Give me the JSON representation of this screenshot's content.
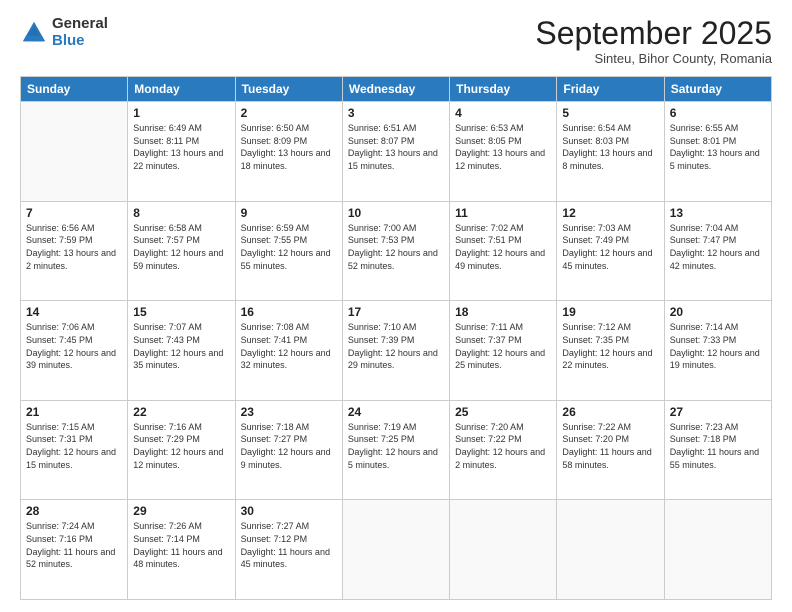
{
  "logo": {
    "general": "General",
    "blue": "Blue"
  },
  "header": {
    "month": "September 2025",
    "location": "Sinteu, Bihor County, Romania"
  },
  "days_of_week": [
    "Sunday",
    "Monday",
    "Tuesday",
    "Wednesday",
    "Thursday",
    "Friday",
    "Saturday"
  ],
  "weeks": [
    [
      {
        "day": "",
        "info": ""
      },
      {
        "day": "1",
        "info": "Sunrise: 6:49 AM\nSunset: 8:11 PM\nDaylight: 13 hours and 22 minutes."
      },
      {
        "day": "2",
        "info": "Sunrise: 6:50 AM\nSunset: 8:09 PM\nDaylight: 13 hours and 18 minutes."
      },
      {
        "day": "3",
        "info": "Sunrise: 6:51 AM\nSunset: 8:07 PM\nDaylight: 13 hours and 15 minutes."
      },
      {
        "day": "4",
        "info": "Sunrise: 6:53 AM\nSunset: 8:05 PM\nDaylight: 13 hours and 12 minutes."
      },
      {
        "day": "5",
        "info": "Sunrise: 6:54 AM\nSunset: 8:03 PM\nDaylight: 13 hours and 8 minutes."
      },
      {
        "day": "6",
        "info": "Sunrise: 6:55 AM\nSunset: 8:01 PM\nDaylight: 13 hours and 5 minutes."
      }
    ],
    [
      {
        "day": "7",
        "info": "Sunrise: 6:56 AM\nSunset: 7:59 PM\nDaylight: 13 hours and 2 minutes."
      },
      {
        "day": "8",
        "info": "Sunrise: 6:58 AM\nSunset: 7:57 PM\nDaylight: 12 hours and 59 minutes."
      },
      {
        "day": "9",
        "info": "Sunrise: 6:59 AM\nSunset: 7:55 PM\nDaylight: 12 hours and 55 minutes."
      },
      {
        "day": "10",
        "info": "Sunrise: 7:00 AM\nSunset: 7:53 PM\nDaylight: 12 hours and 52 minutes."
      },
      {
        "day": "11",
        "info": "Sunrise: 7:02 AM\nSunset: 7:51 PM\nDaylight: 12 hours and 49 minutes."
      },
      {
        "day": "12",
        "info": "Sunrise: 7:03 AM\nSunset: 7:49 PM\nDaylight: 12 hours and 45 minutes."
      },
      {
        "day": "13",
        "info": "Sunrise: 7:04 AM\nSunset: 7:47 PM\nDaylight: 12 hours and 42 minutes."
      }
    ],
    [
      {
        "day": "14",
        "info": "Sunrise: 7:06 AM\nSunset: 7:45 PM\nDaylight: 12 hours and 39 minutes."
      },
      {
        "day": "15",
        "info": "Sunrise: 7:07 AM\nSunset: 7:43 PM\nDaylight: 12 hours and 35 minutes."
      },
      {
        "day": "16",
        "info": "Sunrise: 7:08 AM\nSunset: 7:41 PM\nDaylight: 12 hours and 32 minutes."
      },
      {
        "day": "17",
        "info": "Sunrise: 7:10 AM\nSunset: 7:39 PM\nDaylight: 12 hours and 29 minutes."
      },
      {
        "day": "18",
        "info": "Sunrise: 7:11 AM\nSunset: 7:37 PM\nDaylight: 12 hours and 25 minutes."
      },
      {
        "day": "19",
        "info": "Sunrise: 7:12 AM\nSunset: 7:35 PM\nDaylight: 12 hours and 22 minutes."
      },
      {
        "day": "20",
        "info": "Sunrise: 7:14 AM\nSunset: 7:33 PM\nDaylight: 12 hours and 19 minutes."
      }
    ],
    [
      {
        "day": "21",
        "info": "Sunrise: 7:15 AM\nSunset: 7:31 PM\nDaylight: 12 hours and 15 minutes."
      },
      {
        "day": "22",
        "info": "Sunrise: 7:16 AM\nSunset: 7:29 PM\nDaylight: 12 hours and 12 minutes."
      },
      {
        "day": "23",
        "info": "Sunrise: 7:18 AM\nSunset: 7:27 PM\nDaylight: 12 hours and 9 minutes."
      },
      {
        "day": "24",
        "info": "Sunrise: 7:19 AM\nSunset: 7:25 PM\nDaylight: 12 hours and 5 minutes."
      },
      {
        "day": "25",
        "info": "Sunrise: 7:20 AM\nSunset: 7:22 PM\nDaylight: 12 hours and 2 minutes."
      },
      {
        "day": "26",
        "info": "Sunrise: 7:22 AM\nSunset: 7:20 PM\nDaylight: 11 hours and 58 minutes."
      },
      {
        "day": "27",
        "info": "Sunrise: 7:23 AM\nSunset: 7:18 PM\nDaylight: 11 hours and 55 minutes."
      }
    ],
    [
      {
        "day": "28",
        "info": "Sunrise: 7:24 AM\nSunset: 7:16 PM\nDaylight: 11 hours and 52 minutes."
      },
      {
        "day": "29",
        "info": "Sunrise: 7:26 AM\nSunset: 7:14 PM\nDaylight: 11 hours and 48 minutes."
      },
      {
        "day": "30",
        "info": "Sunrise: 7:27 AM\nSunset: 7:12 PM\nDaylight: 11 hours and 45 minutes."
      },
      {
        "day": "",
        "info": ""
      },
      {
        "day": "",
        "info": ""
      },
      {
        "day": "",
        "info": ""
      },
      {
        "day": "",
        "info": ""
      }
    ]
  ]
}
